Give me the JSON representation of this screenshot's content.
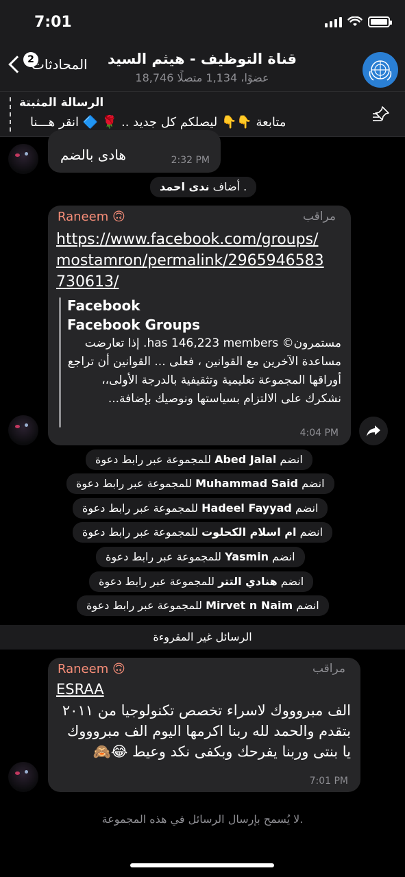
{
  "status_bar": {
    "time": "7:01"
  },
  "header": {
    "back_label": "المحادثات",
    "back_badge": "2",
    "title": "قناة التوظيف - هيثم السيد",
    "subtitle": "18,746 عضوًا، 1,134 متصلًا"
  },
  "pinned": {
    "title": "الرسالة المثبتة",
    "text": "متابعة 👇👇 ليصلكم كل جديد .. 🌹 🔷 انقر هـــنا"
  },
  "messages": {
    "m1": {
      "text": "هادى بالضم",
      "time": "2:32 PM"
    },
    "added": {
      "prefix": ". أضاف",
      "name": "ندى احمد"
    },
    "m2": {
      "sender": "Raneem 🙃",
      "role": "مراقب",
      "link": "https://www.facebook.com/groups/mostamron/permalink/2965946583730613/",
      "preview_site": "Facebook",
      "preview_title": "Facebook Groups",
      "preview_desc": "مستمرون© has 146,223 members. إذا تعارضت مساعدة الآخرين مع القوانين ، فعلى ... القوانين أن تراجع أوراقها المجموعة تعليمية وتثقيفية بالدرجة الأولى،، نشكرك على الالتزام بسياستها ونوصيك بإضافة...",
      "time": "4:04 PM"
    },
    "joins": [
      {
        "prefix": "انضم",
        "name": "Abed Jalal",
        "suffix": "للمجموعة عبر رابط دعوة"
      },
      {
        "prefix": "انضم",
        "name": "Muhammad Said",
        "suffix": "للمجموعة عبر رابط دعوة"
      },
      {
        "prefix": "انضم",
        "name": "Hadeel Fayyad",
        "suffix": "للمجموعة عبر رابط دعوة"
      },
      {
        "prefix": "انضم",
        "name": "ام اسلام الكحلوت",
        "suffix": "للمجموعة عبر رابط دعوة"
      },
      {
        "prefix": "انضم",
        "name": "Yasmin",
        "suffix": "للمجموعة عبر رابط دعوة"
      },
      {
        "prefix": "انضم",
        "name": "هنادي التتر",
        "suffix": "للمجموعة عبر رابط دعوة"
      },
      {
        "prefix": "انضم",
        "name": "Mirvet n Naim",
        "suffix": "للمجموعة عبر رابط دعوة"
      }
    ],
    "unread_label": "الرسائل غير المقروءة",
    "m3": {
      "sender": "Raneem 🙃",
      "role": "مراقب",
      "mention": "ESRAA",
      "body": "الف مبروووك لاسراء تخصص تكنولوجيا من ٢٠١١ بتقدم والحمد لله ربنا اكرمها اليوم الف مبروووك يا بنتى وربنا يفرحك وبكفى نكد وعيط 😂🙈",
      "time": "7:01 PM"
    }
  },
  "footer_note": "لا يُسمح بإرسال الرسائل في هذه المجموعة."
}
